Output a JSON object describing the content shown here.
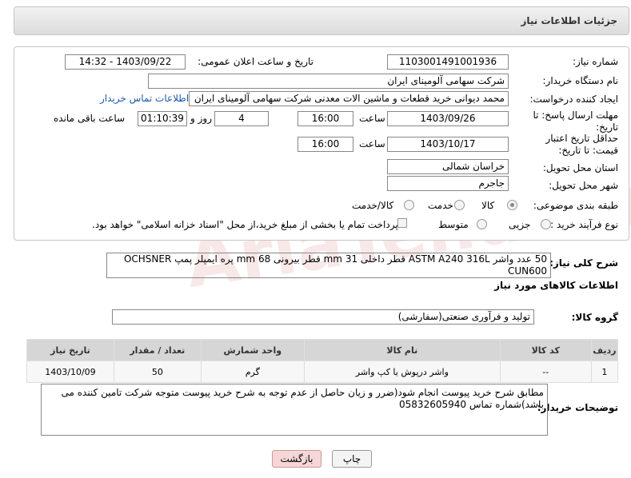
{
  "header": {
    "title": "جزئیات اطلاعات نیاز"
  },
  "fields": {
    "need_number_label": "شماره نیاز:",
    "need_number": "1103001491001936",
    "announce_label": "تاریخ و ساعت اعلان عمومی:",
    "announce_value": "1403/09/22 - 14:32",
    "buyer_org_label": "نام دستگاه خریدار:",
    "buyer_org": "شرکت سهامی آلومینای ایران",
    "requester_label": "ایجاد کننده درخواست:",
    "requester": "محمد دیوانی خرید قطعات و ماشین الات معدنی شرکت سهامی آلومینای ایران",
    "contact_link": "اطلاعات تماس خریدار",
    "deadline_label": "مهلت ارسال پاسخ: تا تاریخ:",
    "deadline_date": "1403/09/26",
    "time_label": "ساعت",
    "deadline_time": "16:00",
    "days_count": "4",
    "days_label": "روز و",
    "remaining_time": "01:10:39",
    "remaining_label": "ساعت باقی مانده",
    "validity_label": "حداقل تاریخ اعتبار قیمت: تا تاریخ:",
    "validity_date": "1403/10/17",
    "validity_time": "16:00",
    "province_label": "استان محل تحویل:",
    "province": "خراسان شمالی",
    "city_label": "شهر محل تحویل:",
    "city": "جاجرم",
    "category_label": "طبقه بندی موضوعی:",
    "category_options": [
      "کالا",
      "خدمت",
      "کالا/خدمت"
    ],
    "process_label": "نوع فرآیند خرید :",
    "process_options": [
      "جزیی",
      "متوسط"
    ],
    "payment_note": "پرداخت تمام یا بخشی از مبلغ خرید،از محل \"اسناد خزانه اسلامی\" خواهد بود."
  },
  "description": {
    "label": "شرح کلی نیاز:",
    "text": "50 عدد واشر ASTM A240 316L قطر داخلی 31 mm قطر بیرونی 68 mm پره ایمپلر  پمپ OCHSNER CUN600"
  },
  "goods_section_title": "اطلاعات کالاهای مورد نیاز",
  "goods_group": {
    "label": "گروه کالا:",
    "value": "تولید و فرآوری صنعتی(سفارشی)"
  },
  "table": {
    "headers": [
      "ردیف",
      "کد کالا",
      "نام کالا",
      "واحد شمارش",
      "تعداد / مقدار",
      "تاریخ نیاز"
    ],
    "rows": [
      [
        "1",
        "--",
        "واشر درپوش یا کپ واشر",
        "گرم",
        "50",
        "1403/10/09"
      ]
    ]
  },
  "buyer_notes": {
    "label": "توضیحات خریدار:",
    "text": "مطابق شرح خرید پیوست انجام شود(ضرر و زیان حاصل از عدم توجه به شرح خرید پیوست متوجه شرکت تامین کننده می باشد)شماره تماس 05832605940"
  },
  "buttons": {
    "print": "چاپ",
    "back": "بازگشت"
  },
  "watermark": "AriaTender.neT",
  "colors": {
    "link": "#1e5aa8",
    "back_button": "#f6d6d6"
  }
}
